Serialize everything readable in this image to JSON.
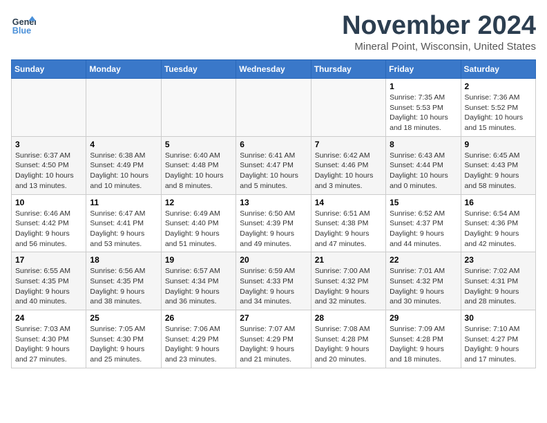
{
  "logo": {
    "line1": "General",
    "line2": "Blue"
  },
  "title": "November 2024",
  "location": "Mineral Point, Wisconsin, United States",
  "days_of_week": [
    "Sunday",
    "Monday",
    "Tuesday",
    "Wednesday",
    "Thursday",
    "Friday",
    "Saturday"
  ],
  "weeks": [
    [
      {
        "num": "",
        "info": ""
      },
      {
        "num": "",
        "info": ""
      },
      {
        "num": "",
        "info": ""
      },
      {
        "num": "",
        "info": ""
      },
      {
        "num": "",
        "info": ""
      },
      {
        "num": "1",
        "info": "Sunrise: 7:35 AM\nSunset: 5:53 PM\nDaylight: 10 hours and 18 minutes."
      },
      {
        "num": "2",
        "info": "Sunrise: 7:36 AM\nSunset: 5:52 PM\nDaylight: 10 hours and 15 minutes."
      }
    ],
    [
      {
        "num": "3",
        "info": "Sunrise: 6:37 AM\nSunset: 4:50 PM\nDaylight: 10 hours and 13 minutes."
      },
      {
        "num": "4",
        "info": "Sunrise: 6:38 AM\nSunset: 4:49 PM\nDaylight: 10 hours and 10 minutes."
      },
      {
        "num": "5",
        "info": "Sunrise: 6:40 AM\nSunset: 4:48 PM\nDaylight: 10 hours and 8 minutes."
      },
      {
        "num": "6",
        "info": "Sunrise: 6:41 AM\nSunset: 4:47 PM\nDaylight: 10 hours and 5 minutes."
      },
      {
        "num": "7",
        "info": "Sunrise: 6:42 AM\nSunset: 4:46 PM\nDaylight: 10 hours and 3 minutes."
      },
      {
        "num": "8",
        "info": "Sunrise: 6:43 AM\nSunset: 4:44 PM\nDaylight: 10 hours and 0 minutes."
      },
      {
        "num": "9",
        "info": "Sunrise: 6:45 AM\nSunset: 4:43 PM\nDaylight: 9 hours and 58 minutes."
      }
    ],
    [
      {
        "num": "10",
        "info": "Sunrise: 6:46 AM\nSunset: 4:42 PM\nDaylight: 9 hours and 56 minutes."
      },
      {
        "num": "11",
        "info": "Sunrise: 6:47 AM\nSunset: 4:41 PM\nDaylight: 9 hours and 53 minutes."
      },
      {
        "num": "12",
        "info": "Sunrise: 6:49 AM\nSunset: 4:40 PM\nDaylight: 9 hours and 51 minutes."
      },
      {
        "num": "13",
        "info": "Sunrise: 6:50 AM\nSunset: 4:39 PM\nDaylight: 9 hours and 49 minutes."
      },
      {
        "num": "14",
        "info": "Sunrise: 6:51 AM\nSunset: 4:38 PM\nDaylight: 9 hours and 47 minutes."
      },
      {
        "num": "15",
        "info": "Sunrise: 6:52 AM\nSunset: 4:37 PM\nDaylight: 9 hours and 44 minutes."
      },
      {
        "num": "16",
        "info": "Sunrise: 6:54 AM\nSunset: 4:36 PM\nDaylight: 9 hours and 42 minutes."
      }
    ],
    [
      {
        "num": "17",
        "info": "Sunrise: 6:55 AM\nSunset: 4:35 PM\nDaylight: 9 hours and 40 minutes."
      },
      {
        "num": "18",
        "info": "Sunrise: 6:56 AM\nSunset: 4:35 PM\nDaylight: 9 hours and 38 minutes."
      },
      {
        "num": "19",
        "info": "Sunrise: 6:57 AM\nSunset: 4:34 PM\nDaylight: 9 hours and 36 minutes."
      },
      {
        "num": "20",
        "info": "Sunrise: 6:59 AM\nSunset: 4:33 PM\nDaylight: 9 hours and 34 minutes."
      },
      {
        "num": "21",
        "info": "Sunrise: 7:00 AM\nSunset: 4:32 PM\nDaylight: 9 hours and 32 minutes."
      },
      {
        "num": "22",
        "info": "Sunrise: 7:01 AM\nSunset: 4:32 PM\nDaylight: 9 hours and 30 minutes."
      },
      {
        "num": "23",
        "info": "Sunrise: 7:02 AM\nSunset: 4:31 PM\nDaylight: 9 hours and 28 minutes."
      }
    ],
    [
      {
        "num": "24",
        "info": "Sunrise: 7:03 AM\nSunset: 4:30 PM\nDaylight: 9 hours and 27 minutes."
      },
      {
        "num": "25",
        "info": "Sunrise: 7:05 AM\nSunset: 4:30 PM\nDaylight: 9 hours and 25 minutes."
      },
      {
        "num": "26",
        "info": "Sunrise: 7:06 AM\nSunset: 4:29 PM\nDaylight: 9 hours and 23 minutes."
      },
      {
        "num": "27",
        "info": "Sunrise: 7:07 AM\nSunset: 4:29 PM\nDaylight: 9 hours and 21 minutes."
      },
      {
        "num": "28",
        "info": "Sunrise: 7:08 AM\nSunset: 4:28 PM\nDaylight: 9 hours and 20 minutes."
      },
      {
        "num": "29",
        "info": "Sunrise: 7:09 AM\nSunset: 4:28 PM\nDaylight: 9 hours and 18 minutes."
      },
      {
        "num": "30",
        "info": "Sunrise: 7:10 AM\nSunset: 4:27 PM\nDaylight: 9 hours and 17 minutes."
      }
    ]
  ]
}
